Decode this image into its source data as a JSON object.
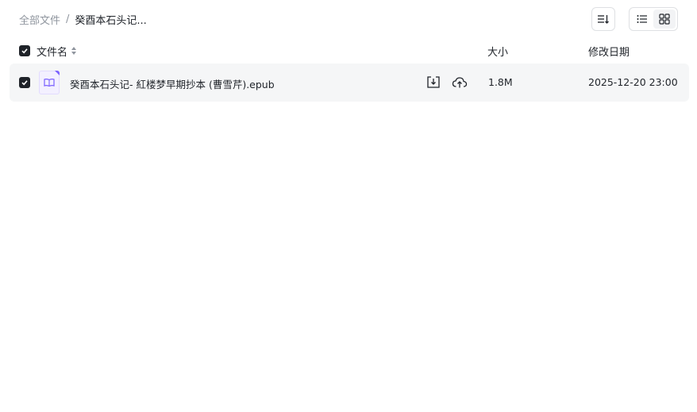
{
  "breadcrumb": {
    "root": "全部文件",
    "separator": "/",
    "current": "癸酉本石头记..."
  },
  "toolbar": {
    "sort_icon": "sort-icon",
    "view_list_icon": "list-view-icon",
    "view_grid_icon": "grid-view-icon"
  },
  "table": {
    "headers": {
      "name": "文件名",
      "size": "大小",
      "modified": "修改日期"
    },
    "rows": [
      {
        "checked": true,
        "icon": "epub-book-icon",
        "name": "癸酉本石头记- 紅楼梦早期抄本 (曹雪芹).epub",
        "size": "1.8M",
        "modified": "2025-12-20 23:00"
      }
    ]
  },
  "colors": {
    "accent": "#7b61ff",
    "row_bg": "#f5f6f7",
    "muted_text": "#8f959e",
    "checkbox": "#1f2329"
  }
}
